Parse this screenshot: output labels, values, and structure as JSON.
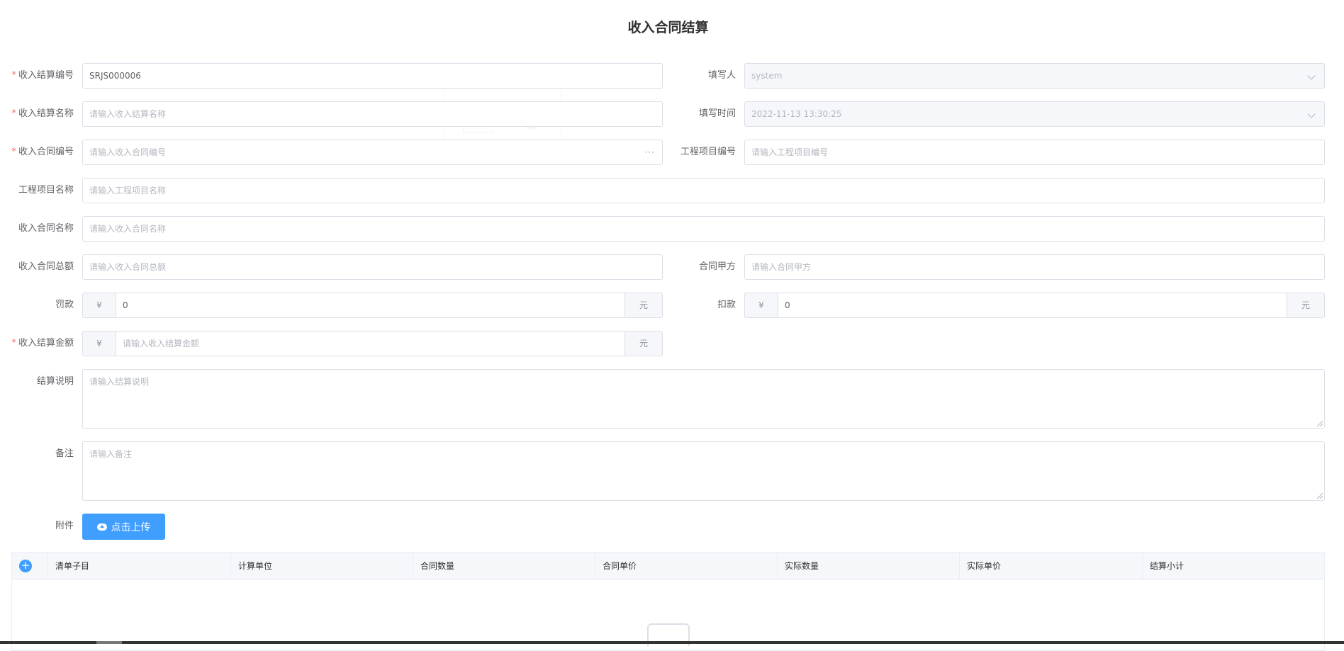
{
  "title": "收入合同结算",
  "fields": {
    "settle_no": {
      "label": "收入结算编号",
      "value": "SRJS000006"
    },
    "filler": {
      "label": "填写人",
      "value": "system"
    },
    "settle_name": {
      "label": "收入结算名称",
      "placeholder": "请输入收入结算名称"
    },
    "fill_time": {
      "label": "填写时间",
      "value": "2022-11-13 13:30:25"
    },
    "contract_no": {
      "label": "收入合同编号",
      "placeholder": "请输入收入合同编号",
      "more": "···"
    },
    "project_no": {
      "label": "工程项目编号",
      "placeholder": "请输入工程项目编号"
    },
    "project_name": {
      "label": "工程项目名称",
      "placeholder": "请输入工程项目名称"
    },
    "contract_name": {
      "label": "收入合同名称",
      "placeholder": "请输入收入合同名称"
    },
    "contract_total": {
      "label": "收入合同总额",
      "placeholder": "请输入收入合同总额"
    },
    "party_a": {
      "label": "合同甲方",
      "placeholder": "请输入合同甲方"
    },
    "penalty": {
      "label": "罚款",
      "prefix": "¥",
      "value": "0",
      "suffix": "元"
    },
    "deduction": {
      "label": "扣款",
      "prefix": "¥",
      "value": "0",
      "suffix": "元"
    },
    "settle_amount": {
      "label": "收入结算金额",
      "prefix": "¥",
      "placeholder": "请输入收入结算金额",
      "suffix": "元"
    },
    "settle_desc": {
      "label": "结算说明",
      "placeholder": "请输入结算说明"
    },
    "remark": {
      "label": "备注",
      "placeholder": "请输入备注"
    },
    "attachment": {
      "label": "附件",
      "button": "点击上传"
    }
  },
  "required_mark": "*",
  "table": {
    "add_icon": "+",
    "columns": [
      "清单子目",
      "计算单位",
      "合同数量",
      "合同单价",
      "实际数量",
      "实际单价",
      "结算小计"
    ]
  },
  "colors": {
    "primary": "#409eff",
    "required": "#f56c6c",
    "border": "#dcdfe6"
  }
}
